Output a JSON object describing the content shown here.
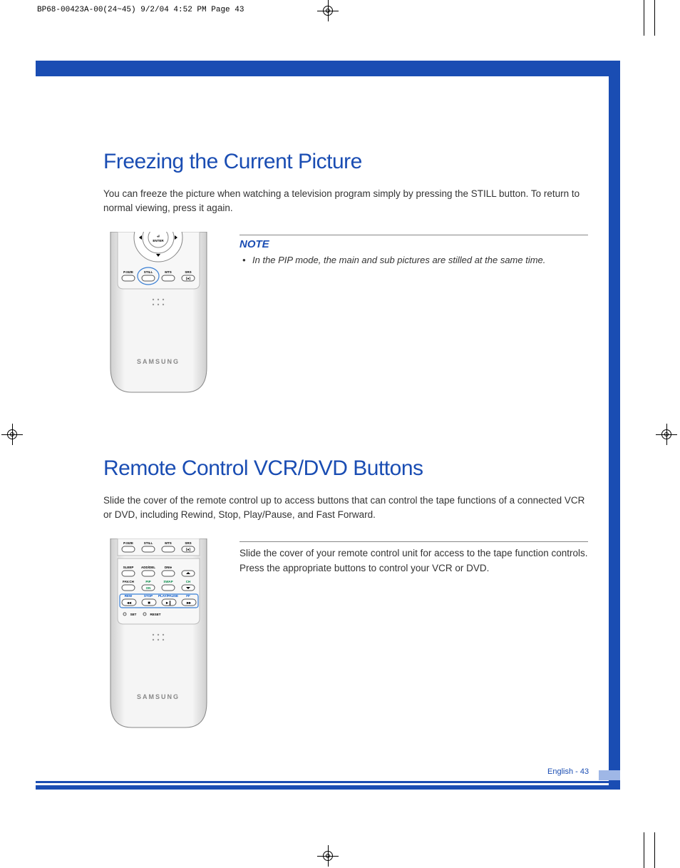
{
  "print_header": "BP68-00423A-00(24~45)  9/2/04  4:52 PM  Page 43",
  "section1": {
    "title": "Freezing the Current Picture",
    "intro": "You can freeze the picture when watching a television program simply by pressing the STILL button. To return to normal viewing, press it again.",
    "note_label": "NOTE",
    "note_text": "In the PIP mode, the main and sub pictures are stilled at the same time."
  },
  "section2": {
    "title": "Remote Control VCR/DVD Buttons",
    "intro": "Slide the cover of the remote control up to access buttons that can control the tape functions of a connected VCR or DVD, including Rewind, Stop, Play/Pause, and Fast Forward.",
    "step": "Slide the cover of your remote control unit for access to the tape function controls. Press the appropriate buttons to control your VCR or DVD."
  },
  "remote1": {
    "enter": "ENTER",
    "row": [
      "P.SIZE",
      "STILL",
      "MTS",
      "SRS"
    ],
    "brand": "SAMSUNG"
  },
  "remote2": {
    "row1": [
      "P.SIZE",
      "STILL",
      "MTS",
      "SRS"
    ],
    "row2": [
      "SLEEP",
      "ADD/DEL",
      "DNIe"
    ],
    "row3": [
      "FAV.CH",
      "PIP",
      "SWAP",
      "CH"
    ],
    "row3b": "ON",
    "row4": [
      "REW",
      "STOP",
      "PLAY/PAUSE",
      "FF"
    ],
    "set": "SET",
    "reset": "RESET",
    "brand": "SAMSUNG"
  },
  "footer": "English - 43"
}
